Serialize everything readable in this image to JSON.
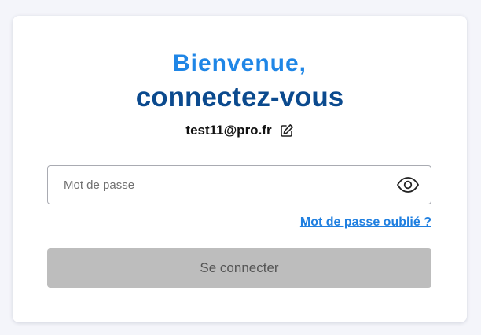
{
  "login": {
    "title_line1": "Bienvenue,",
    "title_line2": "connectez-vous",
    "email": "test11@pro.fr",
    "password": {
      "placeholder": "Mot de passe",
      "value": ""
    },
    "forgot_password": "Mot de passe oublié ?",
    "submit": "Se connecter"
  },
  "icons": {
    "edit": "edit-pencil-icon",
    "show_password": "eye-icon"
  },
  "colors": {
    "page_background": "#f4f5fa",
    "title_accent": "#1f86e6",
    "title_dark": "#0b4a8e",
    "link": "#1f7fe0",
    "button_disabled": "#bdbdbd"
  }
}
